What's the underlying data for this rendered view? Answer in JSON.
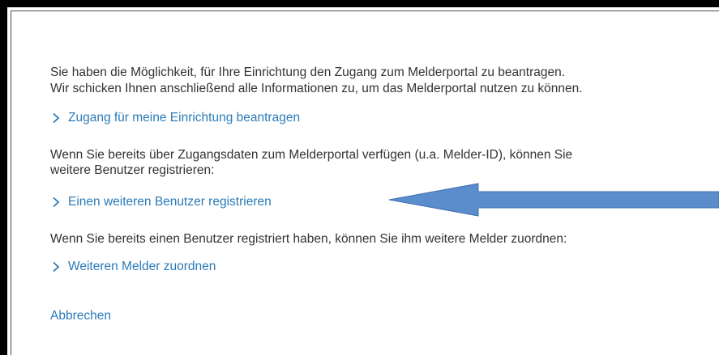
{
  "intro": {
    "line1": "Sie haben die Möglichkeit, für Ihre Einrichtung den Zugang zum Melderportal zu beantragen.",
    "line2": "Wir schicken Ihnen anschließend alle Informationen zu, um das Melderportal nutzen zu können."
  },
  "links": {
    "request_access": "Zugang für meine Einrichtung beantragen",
    "register_user": "Einen weiteren Benutzer registrieren",
    "assign_reporter": "Weiteren Melder zuordnen"
  },
  "existing_access": {
    "line1": "Wenn Sie bereits über Zugangsdaten zum Melderportal verfügen (u.a. Melder-ID), können Sie",
    "line2": "weitere Benutzer registrieren:"
  },
  "existing_user": {
    "line1": "Wenn Sie bereits einen Benutzer registriert haben, können Sie ihm weitere Melder zuordnen:"
  },
  "cancel_label": "Abbrechen",
  "colors": {
    "link": "#2a7ab8",
    "text": "#333333",
    "annotation_arrow": "#5b8ccb"
  },
  "icons": {
    "link_chevron": "chevron-right-icon"
  }
}
